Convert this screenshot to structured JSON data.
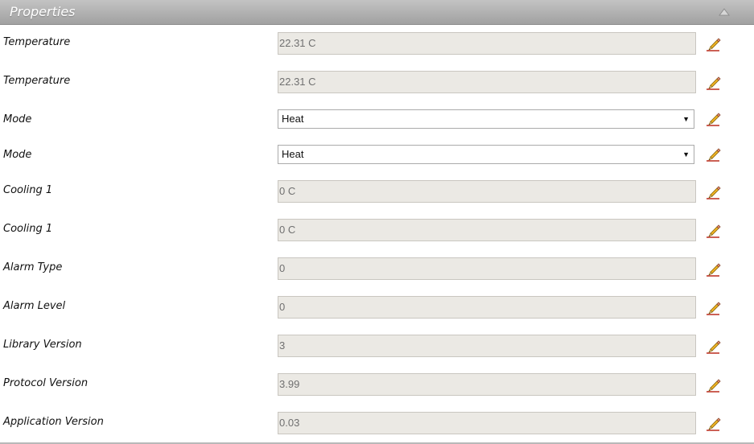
{
  "panel": {
    "title": "Properties",
    "collapse_icon": "triangle-up-icon"
  },
  "properties": [
    {
      "label": "Temperature",
      "value": "22.31 C",
      "type": "text"
    },
    {
      "label": "Temperature",
      "value": "22.31 C",
      "type": "text"
    },
    {
      "label": "Mode",
      "value": "Heat",
      "type": "select"
    },
    {
      "label": "Mode",
      "value": "Heat",
      "type": "select"
    },
    {
      "label": "Cooling 1",
      "value": "0 C",
      "type": "text"
    },
    {
      "label": "Cooling 1",
      "value": "0 C",
      "type": "text"
    },
    {
      "label": "Alarm Type",
      "value": "0",
      "type": "text"
    },
    {
      "label": "Alarm Level",
      "value": "0",
      "type": "text"
    },
    {
      "label": "Library Version",
      "value": "3",
      "type": "text"
    },
    {
      "label": "Protocol Version",
      "value": "3.99",
      "type": "text"
    },
    {
      "label": "Application Version",
      "value": "0.03",
      "type": "text"
    }
  ],
  "icons": {
    "edit": "pencil-icon"
  },
  "colors": {
    "header_top": "#c3c3c3",
    "header_bottom": "#a1a1a1",
    "field_bg": "#ebe9e4",
    "pencil_body": "#f2b423",
    "pencil_tip": "#c0392b"
  }
}
